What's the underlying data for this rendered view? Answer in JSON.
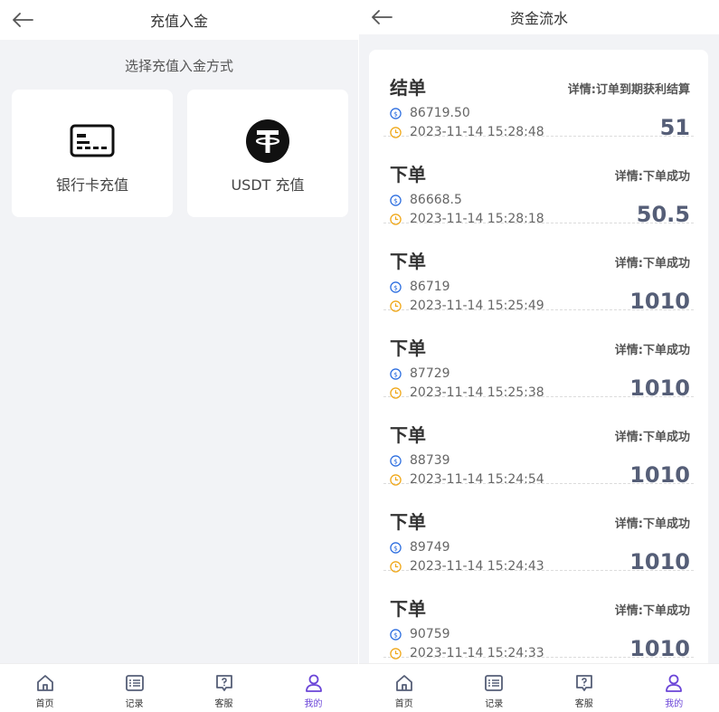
{
  "colors": {
    "accent": "#6b45d8",
    "amount": "#555e77",
    "coin": "#2e6fe0",
    "clock": "#f0a81a"
  },
  "left": {
    "header": {
      "title": "充值入金",
      "back_icon": "arrow-left-icon"
    },
    "section_title": "选择充值入金方式",
    "methods": [
      {
        "label": "银行卡充值",
        "icon": "bank-card-icon"
      },
      {
        "label": "USDT 充值",
        "icon": "tether-icon"
      }
    ]
  },
  "right": {
    "header": {
      "title": "资金流水",
      "back_icon": "arrow-left-icon"
    },
    "records": [
      {
        "type": "结单",
        "detail": "详情:订单到期获利结算",
        "balance": "86719.50",
        "time": "2023-11-14 15:28:48",
        "amount": "51"
      },
      {
        "type": "下单",
        "detail": "详情:下单成功",
        "balance": "86668.5",
        "time": "2023-11-14 15:28:18",
        "amount": "50.5"
      },
      {
        "type": "下单",
        "detail": "详情:下单成功",
        "balance": "86719",
        "time": "2023-11-14 15:25:49",
        "amount": "1010"
      },
      {
        "type": "下单",
        "detail": "详情:下单成功",
        "balance": "87729",
        "time": "2023-11-14 15:25:38",
        "amount": "1010"
      },
      {
        "type": "下单",
        "detail": "详情:下单成功",
        "balance": "88739",
        "time": "2023-11-14 15:24:54",
        "amount": "1010"
      },
      {
        "type": "下单",
        "detail": "详情:下单成功",
        "balance": "89749",
        "time": "2023-11-14 15:24:43",
        "amount": "1010"
      },
      {
        "type": "下单",
        "detail": "详情:下单成功",
        "balance": "90759",
        "time": "2023-11-14 15:24:33",
        "amount": "1010"
      }
    ]
  },
  "tabbar": {
    "items": [
      {
        "label": "首页",
        "icon": "home-icon"
      },
      {
        "label": "记录",
        "icon": "list-icon"
      },
      {
        "label": "客服",
        "icon": "help-chat-icon"
      },
      {
        "label": "我的",
        "icon": "user-icon",
        "active": true
      }
    ]
  }
}
